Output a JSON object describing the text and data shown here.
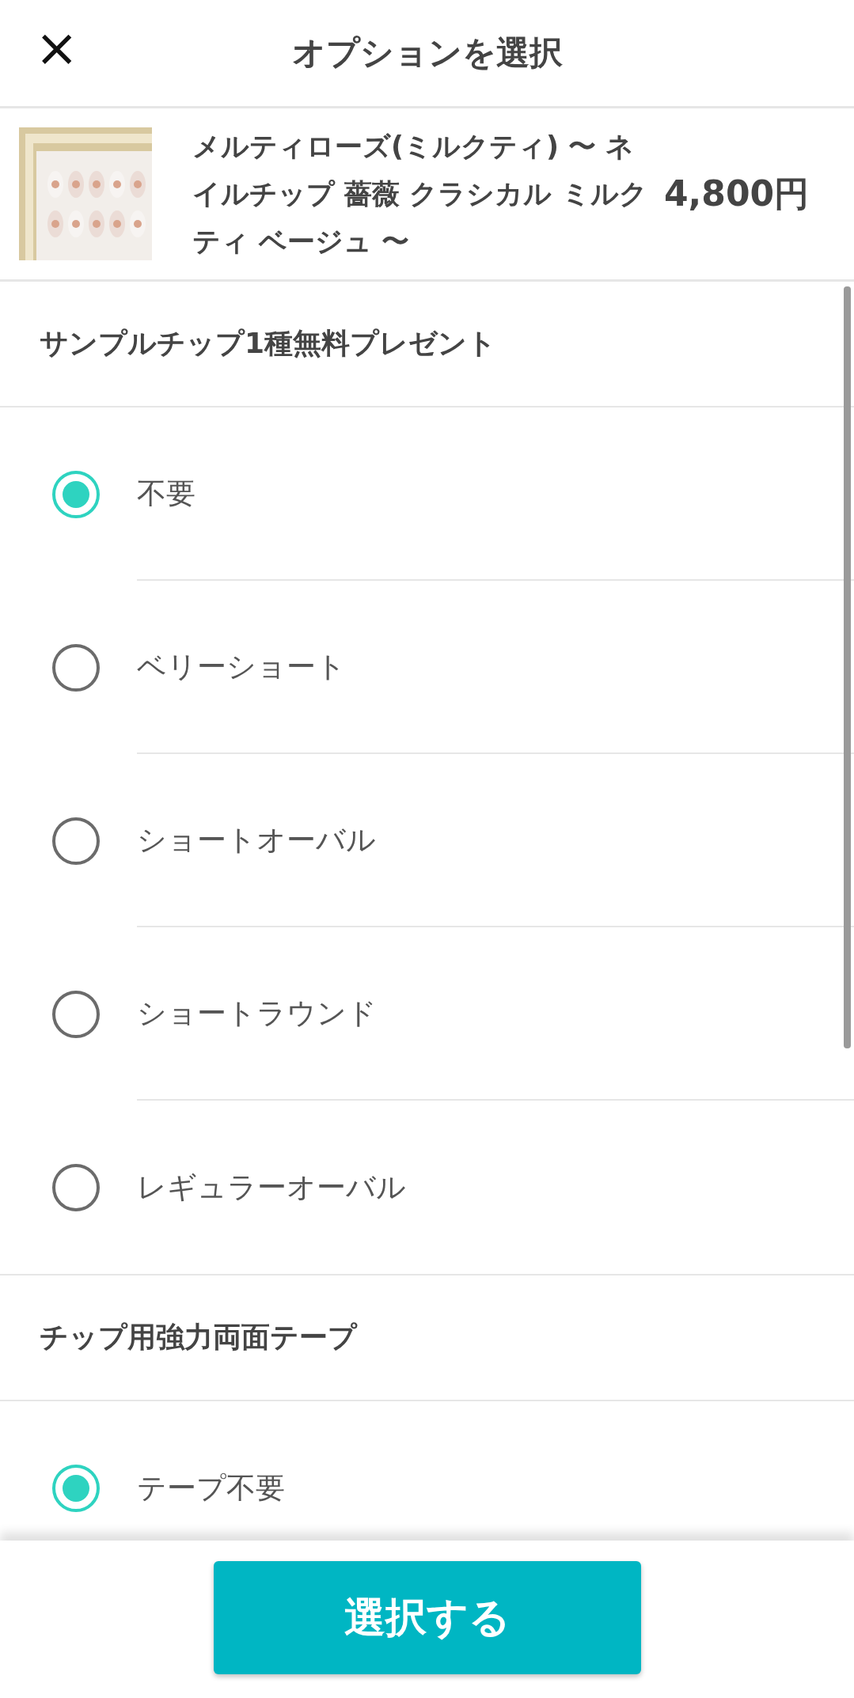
{
  "header": {
    "close": "×",
    "title": "オプションを選択"
  },
  "product": {
    "name": "メルティローズ(ミルクティ)  〜 ネイルチップ 薔薇 クラシカル ミルクティ ベージュ 〜",
    "price": "4,800円"
  },
  "groups": [
    {
      "title": "サンプルチップ1種無料プレゼント",
      "options": [
        {
          "label": "不要",
          "selected": true
        },
        {
          "label": "ベリーショート",
          "selected": false
        },
        {
          "label": "ショートオーバル",
          "selected": false
        },
        {
          "label": "ショートラウンド",
          "selected": false
        },
        {
          "label": "レギュラーオーバル",
          "selected": false
        }
      ]
    },
    {
      "title": "チップ用強力両面テープ",
      "options": [
        {
          "label": "テープ不要",
          "selected": true
        }
      ]
    }
  ],
  "submit": "選択する"
}
